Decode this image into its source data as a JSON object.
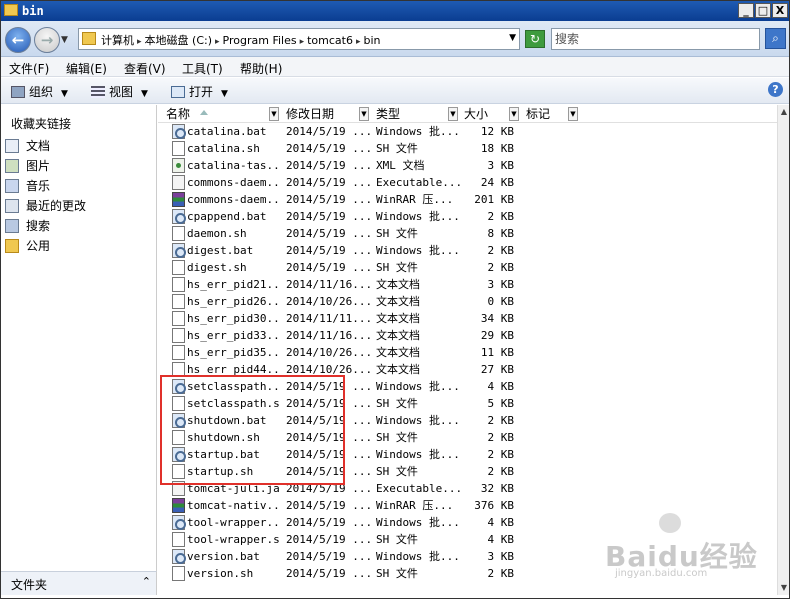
{
  "window": {
    "title": "bin",
    "minimize": "_",
    "maximize": "□",
    "close": "X"
  },
  "address": {
    "crumbs": [
      "计算机",
      "本地磁盘 (C:)",
      "Program Files",
      "tomcat6",
      "bin"
    ],
    "separator": "▸",
    "search_placeholder": "搜索"
  },
  "menu": [
    "文件(F)",
    "编辑(E)",
    "查看(V)",
    "工具(T)",
    "帮助(H)"
  ],
  "toolbar": {
    "organize": "组织",
    "views": "视图",
    "open": "打开",
    "dropdown_arrow": "▼"
  },
  "sidebar": {
    "title": "收藏夹链接",
    "items": [
      "文档",
      "图片",
      "音乐",
      "最近的更改",
      "搜索",
      "公用"
    ],
    "folders_label": "文件夹"
  },
  "columns": {
    "name": "名称",
    "date": "修改日期",
    "type": "类型",
    "size": "大小",
    "tag": "标记"
  },
  "files": [
    {
      "name": "catalina.bat",
      "date": "2014/5/19 ...",
      "type": "Windows 批...",
      "size": "12 KB",
      "icon": "bat"
    },
    {
      "name": "catalina.sh",
      "date": "2014/5/19 ...",
      "type": "SH 文件",
      "size": "18 KB",
      "icon": "doc"
    },
    {
      "name": "catalina-tas...",
      "date": "2014/5/19 ...",
      "type": "XML 文档",
      "size": "3 KB",
      "icon": "xml"
    },
    {
      "name": "commons-daem...",
      "date": "2014/5/19 ...",
      "type": "Executable...",
      "size": "24 KB",
      "icon": "exe"
    },
    {
      "name": "commons-daem...",
      "date": "2014/5/19 ...",
      "type": "WinRAR 压...",
      "size": "201 KB",
      "icon": "rar"
    },
    {
      "name": "cpappend.bat",
      "date": "2014/5/19 ...",
      "type": "Windows 批...",
      "size": "2 KB",
      "icon": "bat"
    },
    {
      "name": "daemon.sh",
      "date": "2014/5/19 ...",
      "type": "SH 文件",
      "size": "8 KB",
      "icon": "doc"
    },
    {
      "name": "digest.bat",
      "date": "2014/5/19 ...",
      "type": "Windows 批...",
      "size": "2 KB",
      "icon": "bat"
    },
    {
      "name": "digest.sh",
      "date": "2014/5/19 ...",
      "type": "SH 文件",
      "size": "2 KB",
      "icon": "doc"
    },
    {
      "name": "hs_err_pid21...",
      "date": "2014/11/16...",
      "type": "文本文档",
      "size": "3 KB",
      "icon": "doc"
    },
    {
      "name": "hs_err_pid26...",
      "date": "2014/10/26...",
      "type": "文本文档",
      "size": "0 KB",
      "icon": "doc"
    },
    {
      "name": "hs_err_pid30...",
      "date": "2014/11/11...",
      "type": "文本文档",
      "size": "34 KB",
      "icon": "doc"
    },
    {
      "name": "hs_err_pid33...",
      "date": "2014/11/16...",
      "type": "文本文档",
      "size": "29 KB",
      "icon": "doc"
    },
    {
      "name": "hs_err_pid35...",
      "date": "2014/10/26...",
      "type": "文本文档",
      "size": "11 KB",
      "icon": "doc"
    },
    {
      "name": "hs_err_pid44...",
      "date": "2014/10/26...",
      "type": "文本文档",
      "size": "27 KB",
      "icon": "doc"
    },
    {
      "name": "setclasspath...",
      "date": "2014/5/19 ...",
      "type": "Windows 批...",
      "size": "4 KB",
      "icon": "bat"
    },
    {
      "name": "setclasspath.sh",
      "date": "2014/5/19 ...",
      "type": "SH 文件",
      "size": "5 KB",
      "icon": "doc"
    },
    {
      "name": "shutdown.bat",
      "date": "2014/5/19 ...",
      "type": "Windows 批...",
      "size": "2 KB",
      "icon": "bat"
    },
    {
      "name": "shutdown.sh",
      "date": "2014/5/19 ...",
      "type": "SH 文件",
      "size": "2 KB",
      "icon": "doc"
    },
    {
      "name": "startup.bat",
      "date": "2014/5/19 ...",
      "type": "Windows 批...",
      "size": "2 KB",
      "icon": "bat"
    },
    {
      "name": "startup.sh",
      "date": "2014/5/19 ...",
      "type": "SH 文件",
      "size": "2 KB",
      "icon": "doc"
    },
    {
      "name": "tomcat-juli.jar",
      "date": "2014/5/19 ...",
      "type": "Executable...",
      "size": "32 KB",
      "icon": "exe"
    },
    {
      "name": "tomcat-nativ...",
      "date": "2014/5/19 ...",
      "type": "WinRAR 压...",
      "size": "376 KB",
      "icon": "rar"
    },
    {
      "name": "tool-wrapper...",
      "date": "2014/5/19 ...",
      "type": "Windows 批...",
      "size": "4 KB",
      "icon": "bat"
    },
    {
      "name": "tool-wrapper.sh",
      "date": "2014/5/19 ...",
      "type": "SH 文件",
      "size": "4 KB",
      "icon": "doc"
    },
    {
      "name": "version.bat",
      "date": "2014/5/19 ...",
      "type": "Windows 批...",
      "size": "3 KB",
      "icon": "bat"
    },
    {
      "name": "version.sh",
      "date": "2014/5/19 ...",
      "type": "SH 文件",
      "size": "2 KB",
      "icon": "doc"
    }
  ],
  "watermark": {
    "brand": "Baidu经验",
    "url": "jingyan.baidu.com"
  },
  "colors": {
    "highlight": "#e0302a",
    "titlebar": "#0a3d91"
  }
}
